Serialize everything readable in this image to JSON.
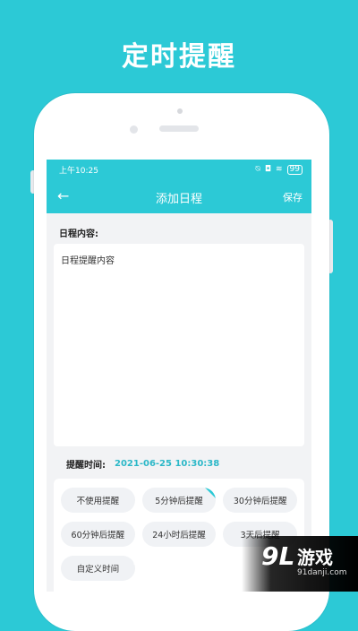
{
  "headline": "定时提醒",
  "status": {
    "time": "上午10:25",
    "battery": "99"
  },
  "appbar": {
    "title": "添加日程",
    "back_icon": "arrow-left-icon",
    "save_label": "保存"
  },
  "form": {
    "content_label": "日程内容:",
    "content_value": "日程提醒内容",
    "time_label": "提醒时间:",
    "time_value": "2021-06-25 10:30:38"
  },
  "options": [
    {
      "label": "不使用提醒",
      "selected": false
    },
    {
      "label": "5分钟后提醒",
      "selected": true
    },
    {
      "label": "30分钟后提醒",
      "selected": false
    },
    {
      "label": "60分钟后提醒",
      "selected": false
    },
    {
      "label": "24小时后提醒",
      "selected": false
    },
    {
      "label": "3天后提醒",
      "selected": false
    },
    {
      "label": "自定义时间",
      "selected": false
    }
  ],
  "watermark": {
    "logo": "9L",
    "name": "游戏",
    "url": "91danji.com"
  },
  "colors": {
    "accent": "#2cc9d6",
    "time_value": "#2cb8c8"
  }
}
